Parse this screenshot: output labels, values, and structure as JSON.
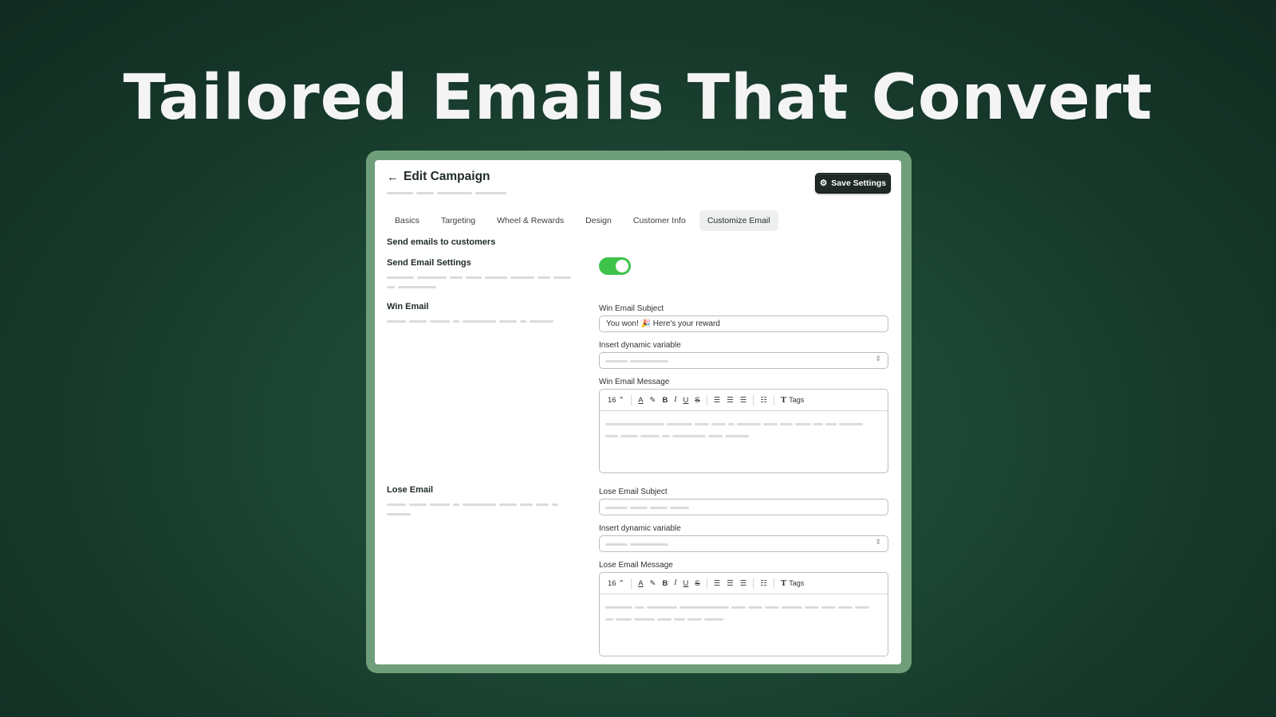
{
  "hero": {
    "title": "Tailored Emails That Convert"
  },
  "header": {
    "back_icon": "arrow-left-icon",
    "title": "Edit Campaign",
    "save_button": {
      "icon": "gear-icon",
      "label": "Save Settings"
    }
  },
  "tabs": [
    {
      "label": "Basics",
      "active": false
    },
    {
      "label": "Targeting",
      "active": false
    },
    {
      "label": "Wheel & Rewards",
      "active": false
    },
    {
      "label": "Design",
      "active": false
    },
    {
      "label": "Customer Info",
      "active": false
    },
    {
      "label": "Customize Email",
      "active": true
    }
  ],
  "send_emails": {
    "heading": "Send emails to customers",
    "settings_label": "Send Email Settings",
    "toggle_on": true,
    "toggle_color": "#3ec24a"
  },
  "win_email": {
    "section_label": "Win Email",
    "subject_label": "Win Email Subject",
    "subject_value": "You won! 🎉 Here's your reward",
    "variable_label": "Insert dynamic variable",
    "message_label": "Win Email Message"
  },
  "lose_email": {
    "section_label": "Lose Email",
    "subject_label": "Lose Email Subject",
    "subject_value": "",
    "variable_label": "Insert dynamic variable",
    "message_label": "Lose Email Message"
  },
  "toolbar": {
    "font_size": "16",
    "stepper": "⌃",
    "text_color": "A",
    "highlight": "✎",
    "bold": "B",
    "italic": "I",
    "underline": "U",
    "strike": "S",
    "align_left": "☰",
    "align_center": "☰",
    "align_right": "☰",
    "list": "☷",
    "tags_icon": "T",
    "tags_label": "Tags"
  },
  "select_chevron": "⇕",
  "colors": {
    "accent": "#3ec24a",
    "dark_button": "#1f2a24",
    "frame": "#6e9f7a"
  }
}
